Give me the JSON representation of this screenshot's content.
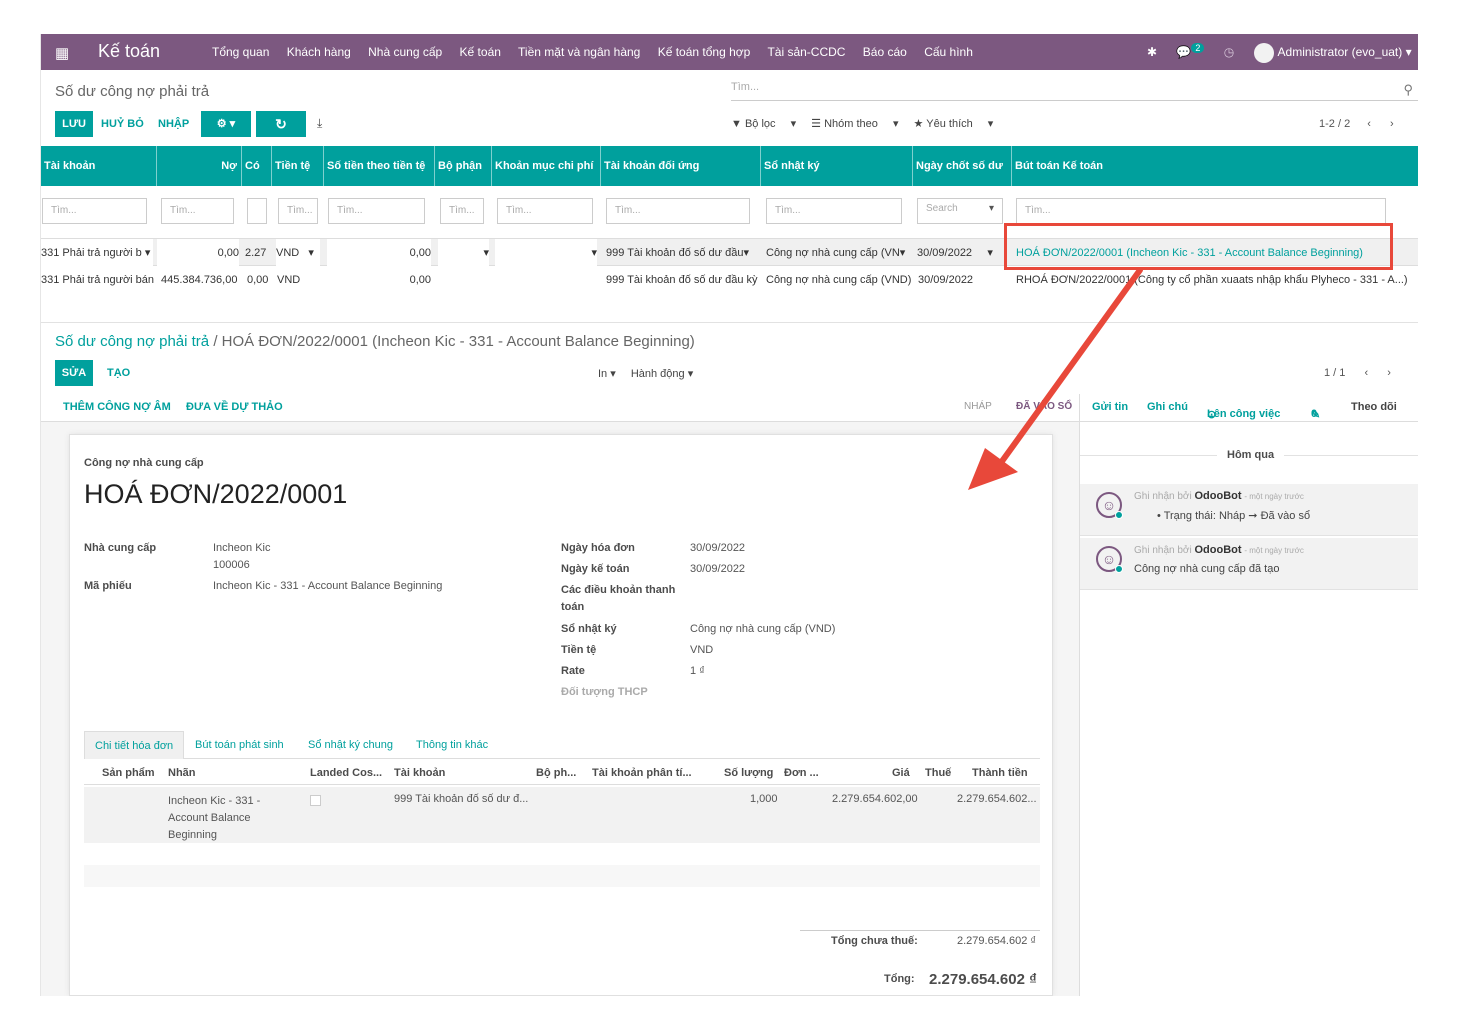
{
  "navbar": {
    "app_name": "Kế toán",
    "menu": [
      "Tổng quan",
      "Khách hàng",
      "Nhà cung cấp",
      "Kế toán",
      "Tiền mặt và ngân hàng",
      "Kế toán tổng hợp",
      "Tài sản-CCDC",
      "Báo cáo",
      "Cấu hình"
    ],
    "messages_count": "2",
    "user": "Administrator (evo_uat)"
  },
  "list_view": {
    "title": "Số dư công nợ phải trả",
    "search_placeholder": "Tìm...",
    "save_label": "LƯU",
    "discard_label": "HUỶ BỎ",
    "import_label": "NHẬP",
    "filters_label": "Bộ lọc",
    "group_by_label": "Nhóm theo",
    "favorites_label": "Yêu thích",
    "pager": "1-2 / 2",
    "columns": [
      "Tài khoản",
      "Nợ",
      "Có",
      "Tiền tệ",
      "Số tiền theo tiền tệ",
      "Bộ phận",
      "Khoản mục chi phí",
      "Tài khoản đối ứng",
      "Sổ nhật ký",
      "Ngày chốt số dư",
      "Bút toán Kế toán"
    ],
    "filter_placeholder": "Tìm...",
    "date_filter_placeholder": "Search",
    "rows": [
      {
        "account": "331 Phải trả người b",
        "debit": "0,00",
        "credit": "2.27",
        "currency": "VND",
        "amount_currency": "0,00",
        "department": "",
        "expense_item": "",
        "counter_account": "999 Tài khoản đố số dư đầu",
        "journal": "Công nợ nhà cung cấp (VN",
        "date": "30/09/2022",
        "move": "HOÁ ĐƠN/2022/0001 (Incheon Kic - 331 - Account Balance Beginning)"
      },
      {
        "account": "331 Phải trả người bán",
        "debit": "445.384.736,00",
        "credit": "0,00",
        "currency": "VND",
        "amount_currency": "0,00",
        "department": "",
        "expense_item": "",
        "counter_account": "999 Tài khoản đố số dư đầu kỳ",
        "journal": "Công nợ nhà cung cấp (VND)",
        "date": "30/09/2022",
        "move": "RHOÁ ĐƠN/2022/0001 (Công ty cổ phần xuaats nhập khẩu Plyheco - 331 - A...)"
      }
    ]
  },
  "form_view": {
    "breadcrumb_parent": "Số dư công nợ phải trả",
    "breadcrumb_separator": "/",
    "breadcrumb_current": "HOÁ ĐƠN/2022/0001 (Incheon Kic - 331 - Account Balance Beginning)",
    "edit_label": "SỬA",
    "create_label": "TẠO",
    "print_label": "In",
    "action_label": "Hành động",
    "pager": "1 / 1",
    "add_debit_label": "THÊM CÔNG NỢ ÂM",
    "reset_draft_label": "ĐƯA VỀ DỰ THẢO",
    "stages": [
      "NHÁP",
      "ĐÃ VÀO SỔ"
    ],
    "doc_type": "Công nợ nhà cung cấp",
    "doc_name": "HOÁ ĐƠN/2022/0001",
    "fields_left": [
      {
        "label": "Nhà cung cấp",
        "value": "Incheon Kic",
        "value2": "100006"
      },
      {
        "label": "Mã phiếu",
        "value": "Incheon Kic - 331 - Account Balance Beginning"
      }
    ],
    "fields_right": [
      {
        "label": "Ngày hóa đơn",
        "value": "30/09/2022"
      },
      {
        "label": "Ngày kế toán",
        "value": "30/09/2022"
      },
      {
        "label": "Các điều khoản thanh",
        "label2": "toán",
        "value": ""
      },
      {
        "label": "Sổ nhật ký",
        "value": "Công nợ nhà cung cấp (VND)"
      },
      {
        "label": "Tiền tệ",
        "value": "VND"
      },
      {
        "label": "Rate",
        "value": "1 ₫"
      },
      {
        "label": "Đối tượng THCP",
        "value": ""
      }
    ],
    "tabs": [
      "Chi tiết hóa đơn",
      "Bút toán phát sinh",
      "Sổ nhật ký chung",
      "Thông tin khác"
    ],
    "line_columns": [
      "Sản phẩm",
      "Nhãn",
      "Landed Cos...",
      "Tài khoản",
      "Bộ ph...",
      "Tài khoản phân tí...",
      "Số lượng",
      "Đơn ...",
      "Giá",
      "Thuế",
      "Thành tiền"
    ],
    "line": {
      "label_1": "Incheon Kic - 331 -",
      "label_2": "Account Balance",
      "label_3": "Beginning",
      "account": "999 Tài khoản đố số dư đ...",
      "quantity": "1,000",
      "price": "2.279.654.602,00",
      "subtotal": "2.279.654.602..."
    },
    "untaxed_label": "Tổng chưa thuế:",
    "untaxed_value": "2.279.654.602 ₫",
    "total_label": "Tổng:",
    "total_value": "2.279.654.602 ₫"
  },
  "chatter": {
    "send_message": "Gửi tin",
    "log_note": "Ghi chú",
    "schedule_activity": "Lên công việc",
    "attachments_count": "0",
    "follow": "Theo dõi",
    "date_separator": "Hôm qua",
    "messages": [
      {
        "prefix": "Ghi nhận bởi",
        "author": "OdooBot",
        "time": "- một ngày trước",
        "body": "• Trạng thái: Nháp ➞ Đã vào sổ"
      },
      {
        "prefix": "Ghi nhận bởi",
        "author": "OdooBot",
        "time": "- một ngày trước",
        "body": "Công nợ nhà cung cấp đã tạo"
      }
    ]
  },
  "colors": {
    "brand": "#7c5880",
    "accent": "#00a09d",
    "annotation": "#e8483a"
  }
}
